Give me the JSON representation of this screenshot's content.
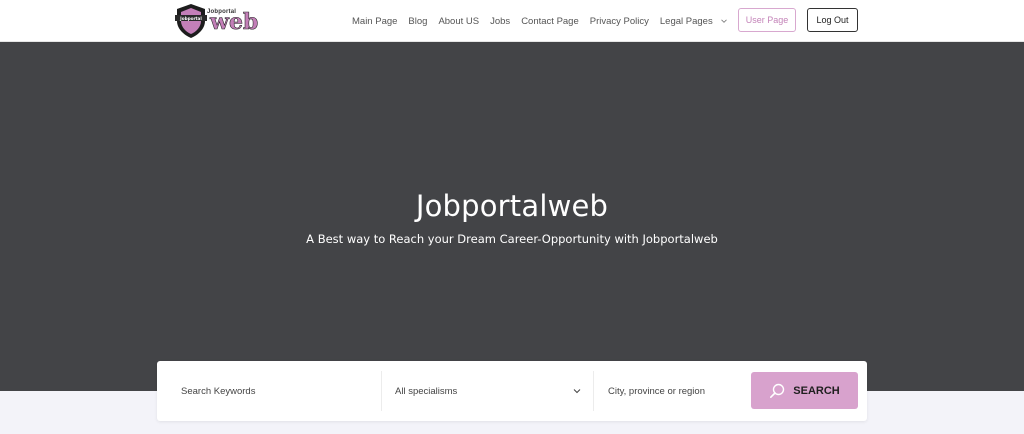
{
  "brand": {
    "logo_mini_text": "Jobportal",
    "logo_web_text": "web",
    "accent": "#d8a2cd"
  },
  "nav": {
    "items": [
      {
        "label": "Main Page"
      },
      {
        "label": "Blog"
      },
      {
        "label": "About US"
      },
      {
        "label": "Jobs"
      },
      {
        "label": "Contact Page"
      },
      {
        "label": "Privacy Policy"
      },
      {
        "label": "Legal Pages",
        "icon": "chevron-down-icon"
      }
    ],
    "user_page_label": "User Page",
    "logout_label": "Log Out"
  },
  "hero": {
    "title": "Jobportalweb",
    "subtitle": "A Best way to Reach your Dream Career-Opportunity with Jobportalweb",
    "background": "#434447"
  },
  "search": {
    "keywords_placeholder": "Search Keywords",
    "specialism_selected": "All specialisms",
    "city_placeholder": "City, province or region",
    "button_label": "SEARCH",
    "button_icon": "search-icon"
  }
}
